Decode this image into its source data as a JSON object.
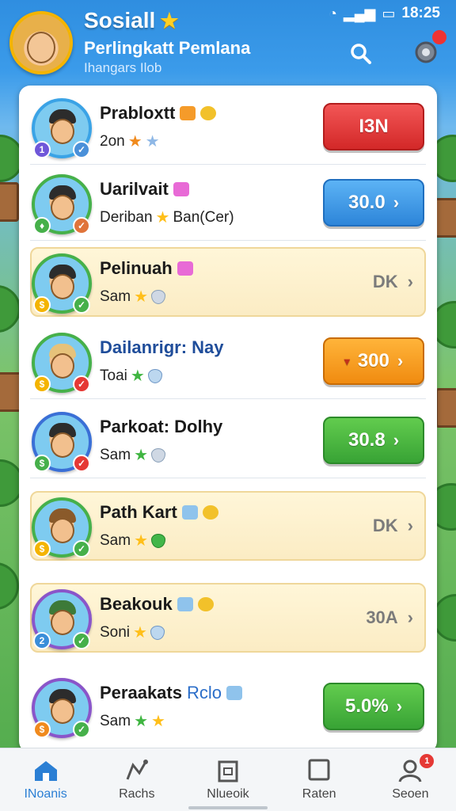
{
  "status": {
    "time": "18:25"
  },
  "header": {
    "title": "Sosiall",
    "subtitle": "Perlingkatt Pemlana",
    "subsubtitle": "Ihangars Ilob"
  },
  "colors": {
    "accent": "#2b7fd4",
    "header_bg": "#2f8ee0"
  },
  "players": [
    {
      "name": "Prabloxtt",
      "name_icons": [
        "orange-gem-icon",
        "gold-coin-icon"
      ],
      "sub": "2on",
      "sub_icons": [
        "orange-star-icon",
        "blue-star-icon"
      ],
      "score": "I3N",
      "score_style": "red",
      "chevron": ""
    },
    {
      "name": "Uarilvait",
      "name_icons": [
        "pink-gem-icon"
      ],
      "sub": "Deriban",
      "sub_extra": "Ban(Cer)",
      "sub_icons": [
        "star-icon"
      ],
      "score": "30.0",
      "score_style": "blue",
      "chevron": "›"
    },
    {
      "name": "Pelinuah",
      "name_icons": [
        "pink-gem-icon"
      ],
      "sub": "Sam",
      "sub_icons": [
        "star-icon",
        "silver-shield-icon"
      ],
      "score": "DK",
      "score_style": "plain",
      "chevron": "›"
    },
    {
      "name": "Dailanrigr: Nay",
      "name_icons": [],
      "sub": "Toai",
      "sub_icons": [
        "green-star-icon",
        "blue-shield-icon"
      ],
      "score": "300",
      "score_prefix": "▾",
      "score_style": "orange",
      "chevron": "›"
    },
    {
      "name": "Parkoat: Dolhy",
      "name_icons": [],
      "sub": "Sam",
      "sub_icons": [
        "green-star-icon",
        "silver-shield-icon"
      ],
      "score": "30.8",
      "score_style": "green",
      "chevron": "›"
    },
    {
      "name": "Path Kart",
      "name_icons": [
        "blue-gem-icon",
        "gold-coin-icon"
      ],
      "sub": "Sam",
      "sub_icons": [
        "star-icon",
        "green-shield-icon"
      ],
      "score": "DK",
      "score_style": "plain",
      "chevron": "›"
    },
    {
      "name": "Beakouk",
      "name_icons": [
        "blue-gem-icon",
        "gold-coin-icon"
      ],
      "sub": "Soni",
      "sub_icons": [
        "star-icon",
        "blue-shield-icon"
      ],
      "score": "30A",
      "score_style": "plain",
      "chevron": "›"
    },
    {
      "name": "Peraakats",
      "name_suffix": "Rclo",
      "name_icons": [
        "blue-gem-icon"
      ],
      "sub": "Sam",
      "sub_icons": [
        "green-star-icon",
        "star-icon"
      ],
      "score": "5.0%",
      "score_style": "green",
      "chevron": "›"
    }
  ],
  "nav": [
    {
      "label": "INoanis",
      "icon": "home-icon"
    },
    {
      "label": "Rachs",
      "icon": "chart-icon"
    },
    {
      "label": "Nlueoik",
      "icon": "inbox-icon"
    },
    {
      "label": "Raten",
      "icon": "square-icon"
    },
    {
      "label": "Seoen",
      "icon": "profile-icon",
      "badge": "1"
    }
  ]
}
